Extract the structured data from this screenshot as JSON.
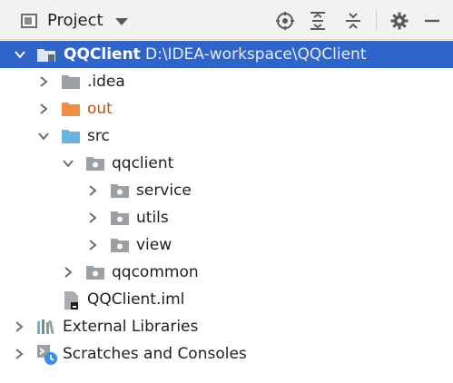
{
  "toolbar": {
    "title": "Project",
    "icons": [
      "panel-icon",
      "locate-icon",
      "expand-all-icon",
      "collapse-all-icon",
      "gear-icon",
      "minimize-icon"
    ]
  },
  "tree": {
    "root": {
      "name": "QQClient",
      "path": "D:\\IDEA-workspace\\QQClient"
    },
    "idea": ".idea",
    "out": "out",
    "src": "src",
    "qqclient": "qqclient",
    "service": "service",
    "utils": "utils",
    "view": "view",
    "qqcommon": "qqcommon",
    "iml": "QQClient.iml",
    "external": "External Libraries",
    "scratches": "Scratches and Consoles"
  },
  "colors": {
    "selection": "#2f65ca",
    "folder_grey": "#9aa0a6",
    "folder_orange": "#f08d49",
    "folder_blue": "#6bb3e0",
    "out_text": "#b5561a"
  }
}
